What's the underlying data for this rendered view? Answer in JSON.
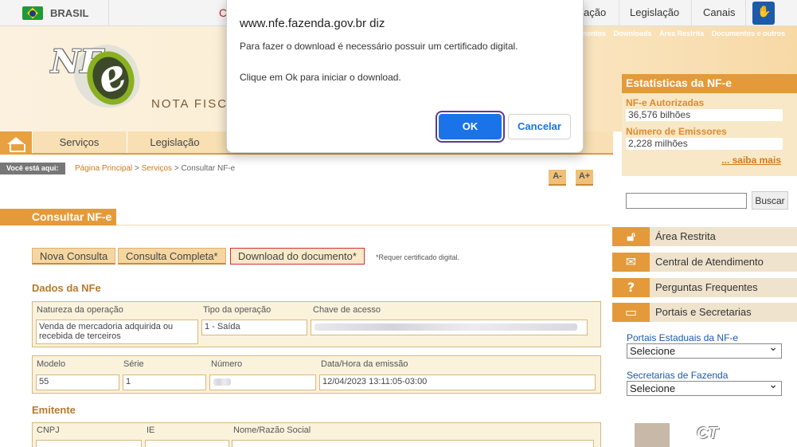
{
  "govbar": {
    "country": "BRASIL",
    "red_link": "C",
    "links": [
      "ação",
      "Legislação",
      "Canais"
    ]
  },
  "header": {
    "top_links": [
      "mentos",
      "Downloads",
      "Área Restrita",
      "Documentos e outros"
    ],
    "logo_text": "NF",
    "subtitle": "NOTA FISCA"
  },
  "menu": {
    "items": [
      "Serviços",
      "Legislação"
    ]
  },
  "breadcrumb": {
    "you_are_here": "Você está aqui:",
    "home": "Página Principal",
    "services": "Serviços",
    "current": "Consultar NF-e",
    "sep": ">"
  },
  "font_controls": {
    "decrease": "A-",
    "increase": "A+"
  },
  "page_title": "Consultar NF-e",
  "buttons": {
    "new_query": "Nova Consulta",
    "full_query": "Consulta Completa*",
    "download": "Download do documento*",
    "note": "*Requer certificado digital."
  },
  "nfe": {
    "section": "Dados da NFe",
    "labels": {
      "natureza": "Natureza da operação",
      "tipo": "Tipo da operação",
      "chave": "Chave de acesso",
      "modelo": "Modelo",
      "serie": "Série",
      "numero": "Número",
      "datahora": "Data/Hora da emissão"
    },
    "values": {
      "natureza": "Venda de mercadoria adquirida ou recebida de terceiros",
      "tipo": "1 - Saída",
      "modelo": "55",
      "serie": "1",
      "datahora": "12/04/2023 13:11:05-03:00"
    }
  },
  "emitente": {
    "section": "Emitente",
    "labels": {
      "cnpj": "CNPJ",
      "ie": "IE",
      "nome": "Nome/Razão Social"
    }
  },
  "stats": {
    "title": "Estatísticas da NF-e",
    "authorized_label": "NF-e Autorizadas",
    "authorized_value": "36,576 bilhões",
    "issuers_label": "Número de Emissores",
    "issuers_value": "2,228 milhões",
    "more": "... saiba mais"
  },
  "search": {
    "button": "Buscar",
    "placeholder": ""
  },
  "right_links": [
    {
      "label": "Área Restrita",
      "icon": "lock-icon"
    },
    {
      "label": "Central de Atendimento",
      "icon": "envelope-icon"
    },
    {
      "label": "Perguntas Frequentes",
      "icon": "question-icon"
    },
    {
      "label": "Portais e Secretarias",
      "icon": "window-icon"
    }
  ],
  "portals": {
    "state_label": "Portais Estaduais da NF-e",
    "state_select": "Selecione",
    "secretaries_label": "Secretarias de Fazenda",
    "secretaries_select": "Selecione"
  },
  "dialog": {
    "origin": "www.nfe.fazenda.gov.br diz",
    "message1": "Para fazer o download é necessário possuir um certificado digital.",
    "message2": "Clique em Ok para iniciar o download.",
    "ok": "OK",
    "cancel": "Cancelar"
  },
  "colors": {
    "accent": "#e49a3a",
    "link": "#d07a1a",
    "dialog_primary": "#1a73e8"
  }
}
